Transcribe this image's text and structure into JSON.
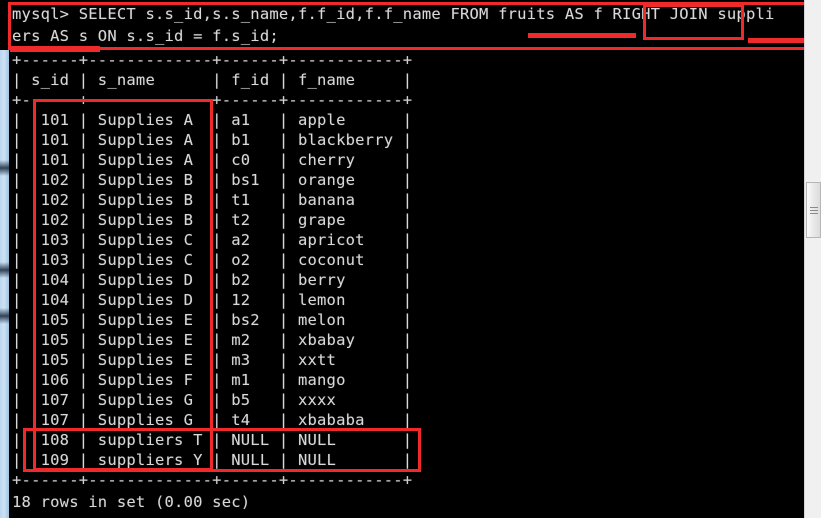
{
  "terminal": {
    "prompt_lines": [
      "mysql> SELECT s.s_id,s.s_name,f.f_id,f.f_name FROM fruits AS f RIGHT JOIN suppli",
      "ers AS s ON s.s_id = f.s_id;"
    ],
    "separator_top": "+------+-------------+------+------------+",
    "header_row": "| s_id | s_name      | f_id | f_name     |",
    "separator_mid": "+------+-------------+------+------------+",
    "separator_bottom": "+------+-------------+------+------------+",
    "footer": "18 rows in set (0.00 sec)",
    "columns": [
      "s_id",
      "s_name",
      "f_id",
      "f_name"
    ],
    "rows": [
      {
        "s_id": "101",
        "s_name": "Supplies A",
        "f_id": "a1",
        "f_name": "apple"
      },
      {
        "s_id": "101",
        "s_name": "Supplies A",
        "f_id": "b1",
        "f_name": "blackberry"
      },
      {
        "s_id": "101",
        "s_name": "Supplies A",
        "f_id": "c0",
        "f_name": "cherry"
      },
      {
        "s_id": "102",
        "s_name": "Supplies B",
        "f_id": "bs1",
        "f_name": "orange"
      },
      {
        "s_id": "102",
        "s_name": "Supplies B",
        "f_id": "t1",
        "f_name": "banana"
      },
      {
        "s_id": "102",
        "s_name": "Supplies B",
        "f_id": "t2",
        "f_name": "grape"
      },
      {
        "s_id": "103",
        "s_name": "Supplies C",
        "f_id": "a2",
        "f_name": "apricot"
      },
      {
        "s_id": "103",
        "s_name": "Supplies C",
        "f_id": "o2",
        "f_name": "coconut"
      },
      {
        "s_id": "104",
        "s_name": "Supplies D",
        "f_id": "b2",
        "f_name": "berry"
      },
      {
        "s_id": "104",
        "s_name": "Supplies D",
        "f_id": "12",
        "f_name": "lemon"
      },
      {
        "s_id": "105",
        "s_name": "Supplies E",
        "f_id": "bs2",
        "f_name": "melon"
      },
      {
        "s_id": "105",
        "s_name": "Supplies E",
        "f_id": "m2",
        "f_name": "xbabay"
      },
      {
        "s_id": "105",
        "s_name": "Supplies E",
        "f_id": "m3",
        "f_name": "xxtt"
      },
      {
        "s_id": "106",
        "s_name": "Supplies F",
        "f_id": "m1",
        "f_name": "mango"
      },
      {
        "s_id": "107",
        "s_name": "Supplies G",
        "f_id": "b5",
        "f_name": "xxxx"
      },
      {
        "s_id": "107",
        "s_name": "Supplies G",
        "f_id": "t4",
        "f_name": "xbababa"
      },
      {
        "s_id": "108",
        "s_name": "suppliers T",
        "f_id": "NULL",
        "f_name": "NULL"
      },
      {
        "s_id": "109",
        "s_name": "suppliers Y",
        "f_id": "NULL",
        "f_name": "NULL"
      }
    ],
    "row_text": [
      "|  101 | Supplies A  | a1   | apple      |",
      "|  101 | Supplies A  | b1   | blackberry |",
      "|  101 | Supplies A  | c0   | cherry     |",
      "|  102 | Supplies B  | bs1  | orange     |",
      "|  102 | Supplies B  | t1   | banana     |",
      "|  102 | Supplies B  | t2   | grape      |",
      "|  103 | Supplies C  | a2   | apricot    |",
      "|  103 | Supplies C  | o2   | coconut    |",
      "|  104 | Supplies D  | b2   | berry      |",
      "|  104 | Supplies D  | 12   | lemon      |",
      "|  105 | Supplies E  | bs2  | melon      |",
      "|  105 | Supplies E  | m2   | xbabay     |",
      "|  105 | Supplies E  | m3   | xxtt       |",
      "|  106 | Supplies F  | m1   | mango      |",
      "|  107 | Supplies G  | b5   | xxxx       |",
      "|  107 | Supplies G  | t4   | xbababa    |",
      "|  108 | suppliers T | NULL | NULL       |",
      "|  109 | suppliers Y | NULL | NULL       |"
    ]
  },
  "annotations": {
    "accent_color": "#ef2a2a",
    "query_box_label": "full-query-highlight",
    "right_join_label": "RIGHT JOIN",
    "fruits_underline_label": "fruits AS f",
    "suppliers_underline_label": "suppli",
    "ers_underline_label": "ers AS s",
    "left_columns_box_label": "s_id and s_name columns",
    "null_rows_box_label": "unmatched supplier rows with NULL fruit values"
  },
  "scrollbar": {
    "orientation": "vertical",
    "position_label": "scroll-thumb"
  }
}
